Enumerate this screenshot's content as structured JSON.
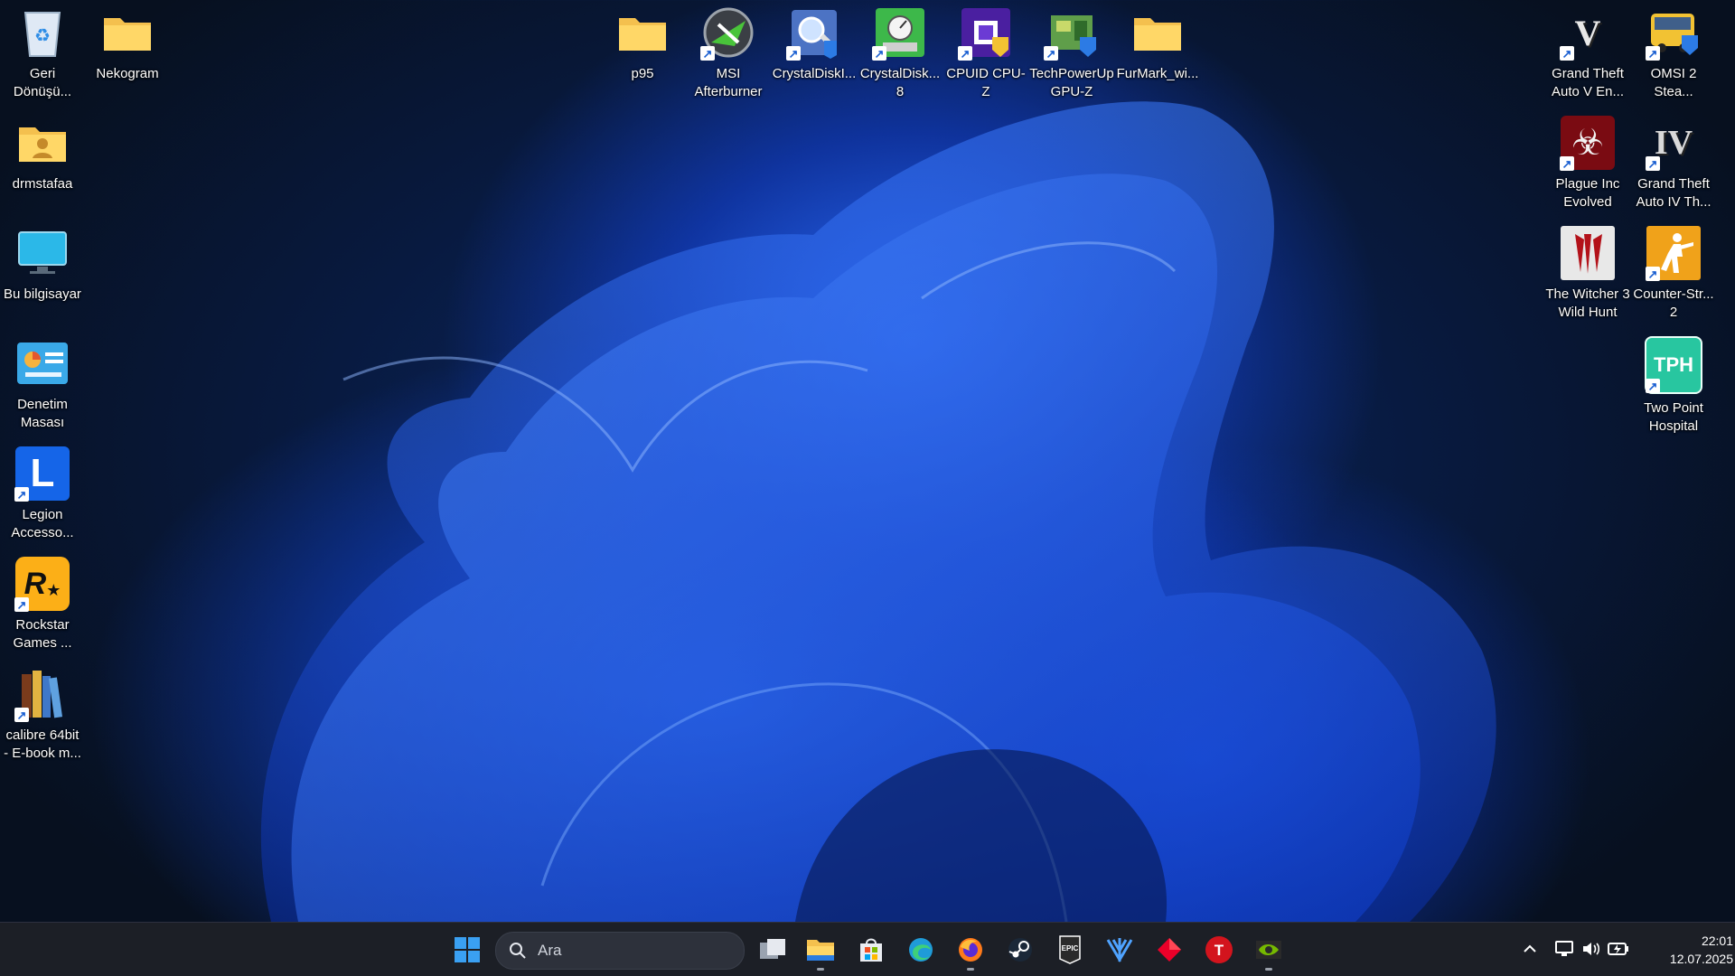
{
  "desktop_icons": [
    {
      "label": "Geri\nDönüşü...",
      "icon": "recycle-bin-icon"
    },
    {
      "label": "Nekogram",
      "icon": "folder-icon"
    },
    {
      "label": "drmstafaa",
      "icon": "user-folder-icon"
    },
    {
      "label": "Bu bilgisayar",
      "icon": "monitor-icon"
    },
    {
      "label": "Denetim\nMasası",
      "icon": "control-panel-icon"
    },
    {
      "label": "Legion\nAccesso...",
      "icon": "legion-icon"
    },
    {
      "label": "Rockstar\nGames ...",
      "icon": "rockstar-icon"
    },
    {
      "label": "calibre 64bit\n- E-book m...",
      "icon": "books-icon"
    },
    {
      "label": "p95",
      "icon": "folder-icon"
    },
    {
      "label": "MSI\nAfterburner",
      "icon": "afterburner-icon"
    },
    {
      "label": "CrystalDiskI...",
      "icon": "crystaldiskinfo-icon"
    },
    {
      "label": "CrystalDisk...\n8",
      "icon": "crystaldiskmark-icon"
    },
    {
      "label": "CPUID CPU-Z",
      "icon": "cpuz-icon"
    },
    {
      "label": "TechPowerUp\nGPU-Z",
      "icon": "gpuz-icon"
    },
    {
      "label": "FurMark_wi...",
      "icon": "folder-icon"
    },
    {
      "label": "Grand Theft\nAuto V En...",
      "icon": "gta5-icon"
    },
    {
      "label": "OMSI 2\nStea...",
      "icon": "bus-icon"
    },
    {
      "label": "Plague Inc\nEvolved",
      "icon": "biohazard-icon"
    },
    {
      "label": "Grand Theft\nAuto IV Th...",
      "icon": "gta4-icon"
    },
    {
      "label": "The Witcher 3\nWild Hunt",
      "icon": "witcher-icon"
    },
    {
      "label": "Counter-Str...\n2",
      "icon": "counter-strike-icon"
    },
    {
      "label": "Two Point\nHospital",
      "icon": "tph-icon"
    }
  ],
  "tph_text": "TPH",
  "taskbar": {
    "search_placeholder": "Ara",
    "apps": [
      "windows-start",
      "task-view",
      "file-explorer",
      "microsoft-store",
      "edge",
      "firefox",
      "steam",
      "epic-games",
      "ea-app",
      "riot-client",
      "t-app",
      "nvidia"
    ],
    "clock_time": "22:01",
    "clock_date": "12.07.2025"
  },
  "colors": {
    "accent": "#1e5dff",
    "taskbar": "#1c1f26"
  }
}
